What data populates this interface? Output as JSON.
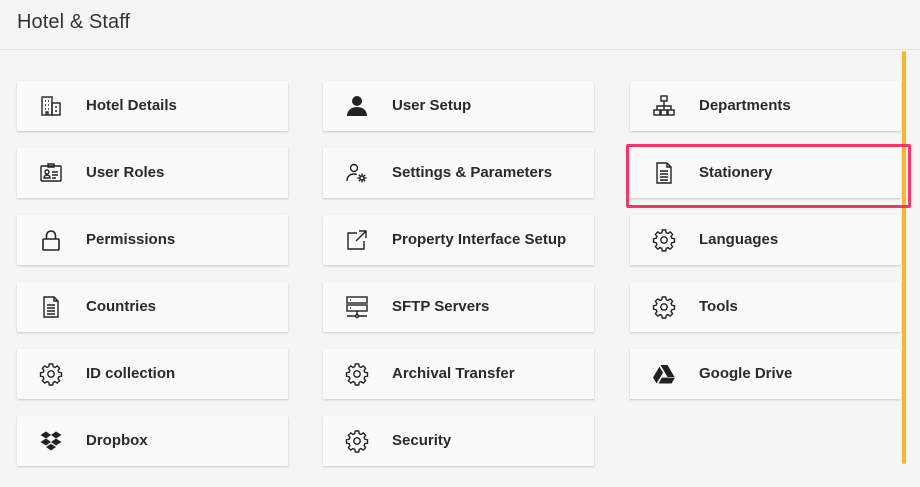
{
  "header": {
    "title": "Hotel & Staff"
  },
  "accent_color": "#f5b82e",
  "highlight_color": "#f2386b",
  "tiles": [
    {
      "label": "Hotel Details",
      "icon": "building-icon"
    },
    {
      "label": "User Setup",
      "icon": "user-icon"
    },
    {
      "label": "Departments",
      "icon": "org-chart-icon"
    },
    {
      "label": "User Roles",
      "icon": "id-card-icon"
    },
    {
      "label": "Settings & Parameters",
      "icon": "user-gear-icon"
    },
    {
      "label": "Stationery",
      "icon": "document-icon",
      "highlighted": true
    },
    {
      "label": "Permissions",
      "icon": "lock-icon"
    },
    {
      "label": "Property Interface Setup",
      "icon": "external-link-icon"
    },
    {
      "label": "Languages",
      "icon": "gear-icon"
    },
    {
      "label": "Countries",
      "icon": "document-icon"
    },
    {
      "label": "SFTP Servers",
      "icon": "server-icon"
    },
    {
      "label": "Tools",
      "icon": "gear-icon"
    },
    {
      "label": "ID collection",
      "icon": "gear-icon"
    },
    {
      "label": "Archival Transfer",
      "icon": "gear-icon"
    },
    {
      "label": "Google Drive",
      "icon": "google-drive-icon"
    },
    {
      "label": "Dropbox",
      "icon": "dropbox-icon"
    },
    {
      "label": "Security",
      "icon": "gear-icon"
    }
  ]
}
